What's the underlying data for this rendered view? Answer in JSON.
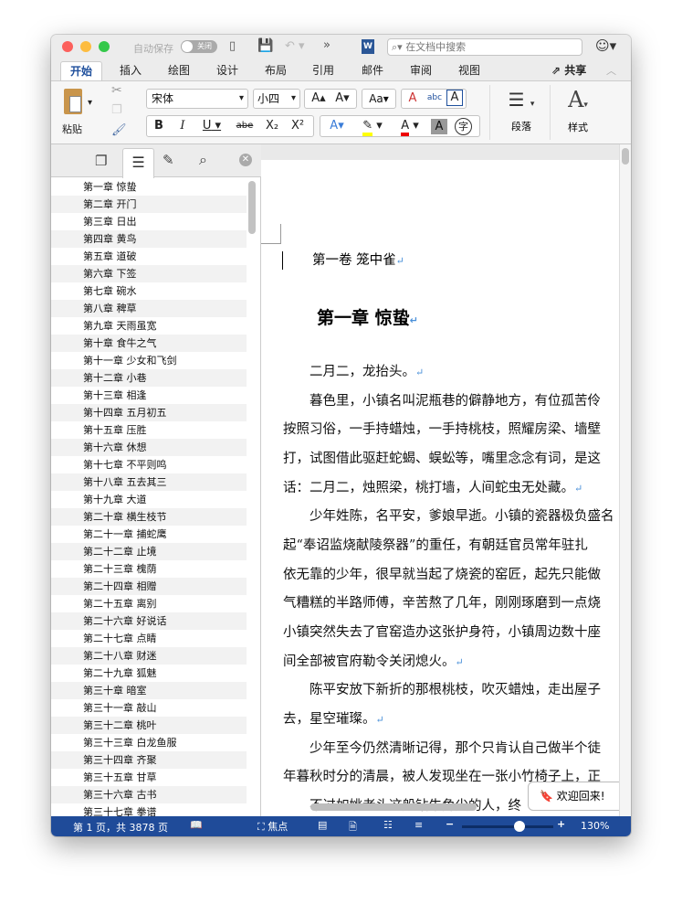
{
  "titlebar": {
    "autosave_label": "自动保存",
    "autosave_toggle": "关闭",
    "search_placeholder": "在文档中搜索"
  },
  "tabs": [
    "开始",
    "插入",
    "绘图",
    "设计",
    "布局",
    "引用",
    "邮件",
    "审阅",
    "视图"
  ],
  "share_label": "共享",
  "ribbon": {
    "paste_label": "粘贴",
    "font_name": "宋体",
    "font_size": "小四",
    "bold": "B",
    "italic": "I",
    "underline": "U",
    "strike": "abe",
    "subscript": "X₂",
    "superscript": "X²",
    "paragraph_label": "段落",
    "styles_label": "样式",
    "grow": "A▴",
    "shrink": "A▾",
    "case": "Aa",
    "clear": "A",
    "phonetic": "abc",
    "border": "A",
    "effects": "A",
    "highlight": "✎",
    "color": "A",
    "shade": "A",
    "enclose": "字"
  },
  "sidebar": {
    "chapters": [
      "第一章 惊蛰",
      "第二章 开门",
      "第三章 日出",
      "第四章 黄鸟",
      "第五章 道破",
      "第六章 下签",
      "第七章 碗水",
      "第八章 稗草",
      "第九章 天雨虽宽",
      "第十章 食牛之气",
      "第十一章 少女和飞剑",
      "第十二章 小巷",
      "第十三章 相逢",
      "第十四章 五月初五",
      "第十五章 压胜",
      "第十六章 休想",
      "第十七章 不平则鸣",
      "第十八章 五去其三",
      "第十九章 大道",
      "第二十章 横生枝节",
      "第二十一章 捕蛇鹰",
      "第二十二章 止境",
      "第二十三章 槐荫",
      "第二十四章 相赠",
      "第二十五章 离别",
      "第二十六章 好说话",
      "第二十七章 点睛",
      "第二十八章 财迷",
      "第二十九章 狐魅",
      "第三十章 暗室",
      "第三十一章 敲山",
      "第三十二章 桃叶",
      "第三十三章 白龙鱼服",
      "第三十四章 齐聚",
      "第三十五章 甘草",
      "第三十六章 古书",
      "第三十七章 拳谱"
    ]
  },
  "document": {
    "volume_title": "第一卷 笼中雀",
    "chapter_title": "第一章 惊蛰",
    "lines": [
      {
        "text": "　　二月二，龙抬头。",
        "ret": true
      },
      {
        "text": "　　暮色里，小镇名叫泥瓶巷的僻静地方，有位孤苦伶",
        "ret": false
      },
      {
        "text": "按照习俗，一手持蜡烛，一手持桃枝，照耀房梁、墙壁",
        "ret": false
      },
      {
        "text": "打，试图借此驱赶蛇蝎、蜈蚣等，嘴里念念有词，是这",
        "ret": false
      },
      {
        "text": "话：二月二，烛照梁，桃打墙，人间蛇虫无处藏。",
        "ret": true
      },
      {
        "text": "　　少年姓陈，名平安，爹娘早逝。小镇的瓷器极负盛名",
        "ret": false
      },
      {
        "text": "起“奉诏监烧献陵祭器”的重任，有朝廷官员常年驻扎",
        "ret": false
      },
      {
        "text": "依无靠的少年，很早就当起了烧瓷的窑匠，起先只能做",
        "ret": false
      },
      {
        "text": "气糟糕的半路师傅，辛苦熬了几年，刚刚琢磨到一点烧",
        "ret": false
      },
      {
        "text": "小镇突然失去了官窑造办这张护身符，小镇周边数十座",
        "ret": false
      },
      {
        "text": "间全部被官府勒令关闭熄火。",
        "ret": true
      },
      {
        "text": "　　陈平安放下新折的那根桃枝，吹灭蜡烛，走出屋子",
        "ret": false
      },
      {
        "text": "去，星空璀璨。",
        "ret": true
      },
      {
        "text": "　　少年至今仍然清晰记得，那个只肯认自己做半个徒",
        "ret": false
      },
      {
        "text": "年暮秋时分的清晨，被人发现坐在一张小竹椅子上，正",
        "ret": false
      },
      {
        "text": "　　不过如姚老头这般钻牛角尖的人，终",
        "ret": false
      }
    ],
    "return_mark": "↵"
  },
  "welcome": "欢迎回来!",
  "status": {
    "page": "第 1 页，共 3878 页",
    "focus": "焦点",
    "zoom": "130%",
    "zoom_percent": 130
  },
  "colors": {
    "accent": "#1f4b99",
    "active_tab": "#1e4f9c"
  }
}
